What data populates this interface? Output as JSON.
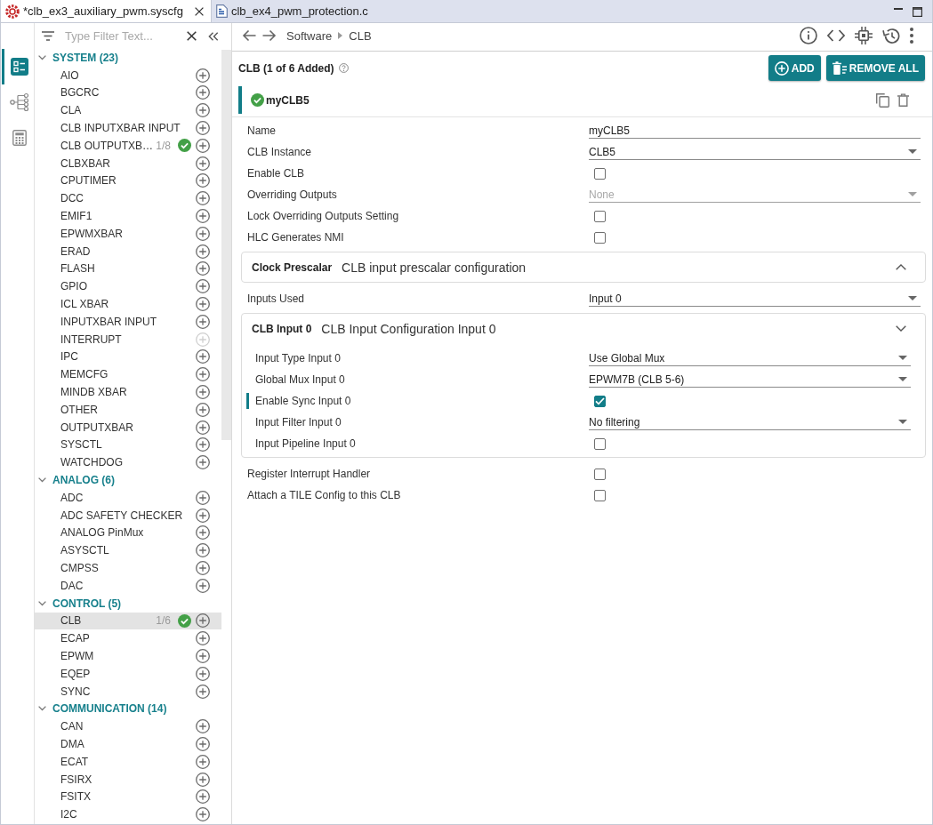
{
  "tabs": [
    {
      "label": "*clb_ex3_auxiliary_pwm.syscfg",
      "kind": "syscfg",
      "selected": true,
      "closable": true
    },
    {
      "label": "clb_ex4_pwm_protection.c",
      "kind": "c",
      "selected": false,
      "closable": false
    }
  ],
  "rail": [
    {
      "selected": true
    },
    {
      "selected": false
    },
    {
      "selected": false
    }
  ],
  "sidebar": {
    "filter": {
      "placeholder": "Type Filter Text..."
    },
    "groups": [
      {
        "label": "SYSTEM (23)",
        "expanded": true,
        "items": [
          {
            "label": "AIO",
            "selected": false,
            "added": false,
            "add_disabled": false
          },
          {
            "label": "BGCRC",
            "selected": false,
            "added": false,
            "add_disabled": false
          },
          {
            "label": "CLA",
            "selected": false,
            "added": false,
            "add_disabled": false
          },
          {
            "label": "CLB INPUTXBAR INPUT",
            "selected": false,
            "added": false,
            "add_disabled": false
          },
          {
            "label": "CLB OUTPUTXB…",
            "count": "1/8",
            "selected": false,
            "added": true,
            "add_disabled": false
          },
          {
            "label": "CLBXBAR",
            "selected": false,
            "added": false,
            "add_disabled": false
          },
          {
            "label": "CPUTIMER",
            "selected": false,
            "added": false,
            "add_disabled": false
          },
          {
            "label": "DCC",
            "selected": false,
            "added": false,
            "add_disabled": false
          },
          {
            "label": "EMIF1",
            "selected": false,
            "added": false,
            "add_disabled": false
          },
          {
            "label": "EPWMXBAR",
            "selected": false,
            "added": false,
            "add_disabled": false
          },
          {
            "label": "ERAD",
            "selected": false,
            "added": false,
            "add_disabled": false
          },
          {
            "label": "FLASH",
            "selected": false,
            "added": false,
            "add_disabled": false
          },
          {
            "label": "GPIO",
            "selected": false,
            "added": false,
            "add_disabled": false
          },
          {
            "label": "ICL XBAR",
            "selected": false,
            "added": false,
            "add_disabled": false
          },
          {
            "label": "INPUTXBAR INPUT",
            "selected": false,
            "added": false,
            "add_disabled": false
          },
          {
            "label": "INTERRUPT",
            "selected": false,
            "added": false,
            "add_disabled": true
          },
          {
            "label": "IPC",
            "selected": false,
            "added": false,
            "add_disabled": false
          },
          {
            "label": "MEMCFG",
            "selected": false,
            "added": false,
            "add_disabled": false
          },
          {
            "label": "MINDB XBAR",
            "selected": false,
            "added": false,
            "add_disabled": false
          },
          {
            "label": "OTHER",
            "selected": false,
            "added": false,
            "add_disabled": false
          },
          {
            "label": "OUTPUTXBAR",
            "selected": false,
            "added": false,
            "add_disabled": false
          },
          {
            "label": "SYSCTL",
            "selected": false,
            "added": false,
            "add_disabled": false
          },
          {
            "label": "WATCHDOG",
            "selected": false,
            "added": false,
            "add_disabled": false
          }
        ]
      },
      {
        "label": "ANALOG (6)",
        "expanded": true,
        "items": [
          {
            "label": "ADC",
            "selected": false,
            "added": false,
            "add_disabled": false
          },
          {
            "label": "ADC SAFETY CHECKER",
            "selected": false,
            "added": false,
            "add_disabled": false
          },
          {
            "label": "ANALOG PinMux",
            "selected": false,
            "added": false,
            "add_disabled": false
          },
          {
            "label": "ASYSCTL",
            "selected": false,
            "added": false,
            "add_disabled": false
          },
          {
            "label": "CMPSS",
            "selected": false,
            "added": false,
            "add_disabled": false
          },
          {
            "label": "DAC",
            "selected": false,
            "added": false,
            "add_disabled": false
          }
        ]
      },
      {
        "label": "CONTROL (5)",
        "expanded": true,
        "items": [
          {
            "label": "CLB",
            "count": "1/6",
            "selected": true,
            "added": true,
            "add_disabled": false
          },
          {
            "label": "ECAP",
            "selected": false,
            "added": false,
            "add_disabled": false
          },
          {
            "label": "EPWM",
            "selected": false,
            "added": false,
            "add_disabled": false
          },
          {
            "label": "EQEP",
            "selected": false,
            "added": false,
            "add_disabled": false
          },
          {
            "label": "SYNC",
            "selected": false,
            "added": false,
            "add_disabled": false
          }
        ]
      },
      {
        "label": "COMMUNICATION (14)",
        "expanded": true,
        "items": [
          {
            "label": "CAN",
            "selected": false,
            "added": false,
            "add_disabled": false
          },
          {
            "label": "DMA",
            "selected": false,
            "added": false,
            "add_disabled": false
          },
          {
            "label": "ECAT",
            "selected": false,
            "added": false,
            "add_disabled": false
          },
          {
            "label": "FSIRX",
            "selected": false,
            "added": false,
            "add_disabled": false
          },
          {
            "label": "FSITX",
            "selected": false,
            "added": false,
            "add_disabled": false
          },
          {
            "label": "I2C",
            "selected": false,
            "added": false,
            "add_disabled": false
          }
        ]
      }
    ]
  },
  "breadcrumb": [
    "Software",
    "CLB"
  ],
  "module": {
    "title": "CLB (1 of 6 Added)",
    "buttons": [
      {
        "label": "ADD",
        "kind": "add"
      },
      {
        "label": "REMOVE ALL",
        "kind": "remove_all"
      }
    ],
    "instances": [
      {
        "name": "myCLB5",
        "selected": true,
        "valid": true
      }
    ]
  },
  "form": {
    "rows": [
      {
        "kind": "text",
        "label": "Name",
        "value": "myCLB5",
        "disabled": false,
        "modified": false
      },
      {
        "kind": "select",
        "label": "CLB Instance",
        "value": "CLB5",
        "disabled": false,
        "modified": false
      },
      {
        "kind": "checkbox",
        "label": "Enable CLB",
        "checked": false,
        "disabled": false,
        "modified": false
      },
      {
        "kind": "select",
        "label": "Overriding Outputs",
        "value": "None",
        "disabled": true,
        "modified": false
      },
      {
        "kind": "checkbox",
        "label": "Lock Overriding Outputs Setting",
        "checked": false,
        "disabled": false,
        "modified": false
      },
      {
        "kind": "checkbox",
        "label": "HLC Generates NMI",
        "checked": false,
        "disabled": false,
        "modified": false
      },
      {
        "kind": "section",
        "title": "Clock Prescalar",
        "description": "CLB input prescalar configuration",
        "expanded": false
      },
      {
        "kind": "select",
        "label": "Inputs Used",
        "value": "Input 0",
        "disabled": false,
        "modified": false
      },
      {
        "kind": "section",
        "title": "CLB Input 0",
        "description": "CLB Input Configuration Input 0",
        "expanded": true,
        "rows": [
          {
            "kind": "select",
            "label": "Input Type Input 0",
            "value": "Use Global Mux",
            "disabled": false,
            "modified": false
          },
          {
            "kind": "select",
            "label": "Global Mux Input 0",
            "value": "EPWM7B (CLB 5-6)",
            "disabled": false,
            "modified": false
          },
          {
            "kind": "checkbox",
            "label": "Enable Sync Input 0",
            "checked": true,
            "disabled": false,
            "modified": true
          },
          {
            "kind": "select",
            "label": "Input Filter Input 0",
            "value": "No filtering",
            "disabled": false,
            "modified": false
          },
          {
            "kind": "checkbox",
            "label": "Input Pipeline Input 0",
            "checked": false,
            "disabled": false,
            "modified": false
          }
        ]
      },
      {
        "kind": "checkbox",
        "label": "Register Interrupt Handler",
        "checked": false,
        "disabled": false,
        "modified": false
      },
      {
        "kind": "checkbox",
        "label": "Attach a TILE Config to this CLB",
        "checked": false,
        "disabled": false,
        "modified": false
      }
    ]
  }
}
